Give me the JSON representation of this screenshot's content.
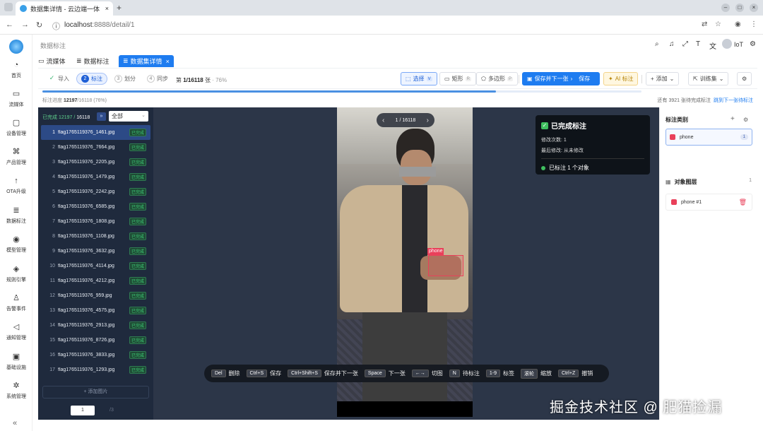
{
  "browser": {
    "tab_title": "数据集详情 - 云边端一体",
    "tab_close": "×",
    "new_tab": "+",
    "url_host": "localhost",
    "url_rest": ":8888/detail/1",
    "window_buttons": [
      "–",
      "□",
      "×"
    ]
  },
  "sidebar": {
    "items": [
      {
        "icon": "◔",
        "label": "首页"
      },
      {
        "icon": "▭",
        "label": "流媒体"
      },
      {
        "icon": "▢",
        "label": "设备管理"
      },
      {
        "icon": "⌘",
        "label": "产品管理"
      },
      {
        "icon": "↑",
        "label": "OTA升级"
      },
      {
        "icon": "≣",
        "label": "数据标注"
      },
      {
        "icon": "◉",
        "label": "模型管理"
      },
      {
        "icon": "◈",
        "label": "规则引擎"
      },
      {
        "icon": "♙",
        "label": "告警事件"
      },
      {
        "icon": "◁",
        "label": "通知管理"
      },
      {
        "icon": "▣",
        "label": "基础设施"
      },
      {
        "icon": "✲",
        "label": "系统管理"
      }
    ],
    "collapse": "«"
  },
  "header": {
    "breadcrumb": "数据标注",
    "user": "IoT"
  },
  "page_tabs": [
    {
      "icon": "▭",
      "label": "流媒体"
    },
    {
      "icon": "≣",
      "label": "数据标注"
    },
    {
      "icon": "≣",
      "label": "数据集详情",
      "close": "×"
    }
  ],
  "toolbar": {
    "steps": [
      {
        "num": "✓",
        "label": "导入"
      },
      {
        "num": "2",
        "label": "标注"
      },
      {
        "num": "3",
        "label": "划分"
      },
      {
        "num": "4",
        "label": "同步"
      }
    ],
    "count_prefix": "第",
    "count_current": "1/16118",
    "count_unit": "张",
    "count_pct": "· 76%",
    "select": {
      "label": "选择",
      "key": "V"
    },
    "rect": {
      "label": "矩形",
      "key": "R"
    },
    "polygon": {
      "label": "多边形",
      "key": "P"
    },
    "save_next": "保存并下一张",
    "save": "保存",
    "ai": "AI 标注",
    "add": "添加",
    "train": "训练集"
  },
  "progress": {
    "label": "标注进度",
    "done": "12197",
    "total": "16118",
    "pct": "(76%)",
    "fraction": 0.7567,
    "remaining": "还有 3921 张待完成标注",
    "jump": "跳到下一张待标注"
  },
  "list": {
    "done_label": "已完成",
    "done_count": "12197",
    "total": "16118",
    "ff": "»",
    "filter": "全部",
    "rows": [
      {
        "idx": "1",
        "name": "flag1765119376_1461.jpg",
        "status": "已完成"
      },
      {
        "idx": "2",
        "name": "flag1765119376_7664.jpg",
        "status": "已完成"
      },
      {
        "idx": "3",
        "name": "flag1765119376_2205.jpg",
        "status": "已完成"
      },
      {
        "idx": "4",
        "name": "flag1765119376_1479.jpg",
        "status": "已完成"
      },
      {
        "idx": "5",
        "name": "flag1765119376_2242.jpg",
        "status": "已完成"
      },
      {
        "idx": "6",
        "name": "flag1765119376_6585.jpg",
        "status": "已完成"
      },
      {
        "idx": "7",
        "name": "flag1765119376_1808.jpg",
        "status": "已完成"
      },
      {
        "idx": "8",
        "name": "flag1765119376_1108.jpg",
        "status": "已完成"
      },
      {
        "idx": "9",
        "name": "flag1765119376_3632.jpg",
        "status": "已完成"
      },
      {
        "idx": "10",
        "name": "flag1765119376_4114.jpg",
        "status": "已完成"
      },
      {
        "idx": "11",
        "name": "flag1765119376_4212.jpg",
        "status": "已完成"
      },
      {
        "idx": "12",
        "name": "flag1765119376_959.jpg",
        "status": "已完成"
      },
      {
        "idx": "13",
        "name": "flag1765119376_4575.jpg",
        "status": "已完成"
      },
      {
        "idx": "14",
        "name": "flag1765119376_2913.jpg",
        "status": "已完成"
      },
      {
        "idx": "15",
        "name": "flag1765119376_8726.jpg",
        "status": "已完成"
      },
      {
        "idx": "16",
        "name": "flag1765119376_3833.jpg",
        "status": "已完成"
      },
      {
        "idx": "17",
        "name": "flag1765119376_1293.jpg",
        "status": "已完成"
      }
    ],
    "add_image": "添加图片",
    "page": "1",
    "page_total": "/3"
  },
  "canvas": {
    "pager": "1 / 16118",
    "bbox_label": "phone",
    "status_title": "已完成标注",
    "edit_count": "修改次数: 1",
    "last_edit": "最后修改: 从未修改",
    "marked": "已标注 1 个对象"
  },
  "shortcuts": [
    {
      "key": "Del",
      "desc": "删除"
    },
    {
      "key": "Ctrl+S",
      "desc": "保存"
    },
    {
      "key": "Ctrl+Shift+S",
      "desc": "保存并下一张"
    },
    {
      "key": "Space",
      "desc": "下一张"
    },
    {
      "key": "←→",
      "desc": "切图"
    },
    {
      "key": "N",
      "desc": "待标注"
    },
    {
      "key": "1-9",
      "desc": "标签"
    },
    {
      "key": "滚轮",
      "desc": "缩放"
    },
    {
      "key": "Ctrl+Z",
      "desc": "撤销"
    }
  ],
  "right_panel": {
    "categories_title": "标注类别",
    "category_name": "phone",
    "category_count": "1",
    "layers_title": "对象图层",
    "layers_count": "1",
    "layer_item": "phone #1"
  },
  "watermark": "掘金技术社区 @ 肥猫捡漏",
  "colors": {
    "accent": "#1e7cf0",
    "label_red": "#e9405a",
    "done_green": "#3fce7a",
    "list_bg": "#1f2a3d"
  }
}
